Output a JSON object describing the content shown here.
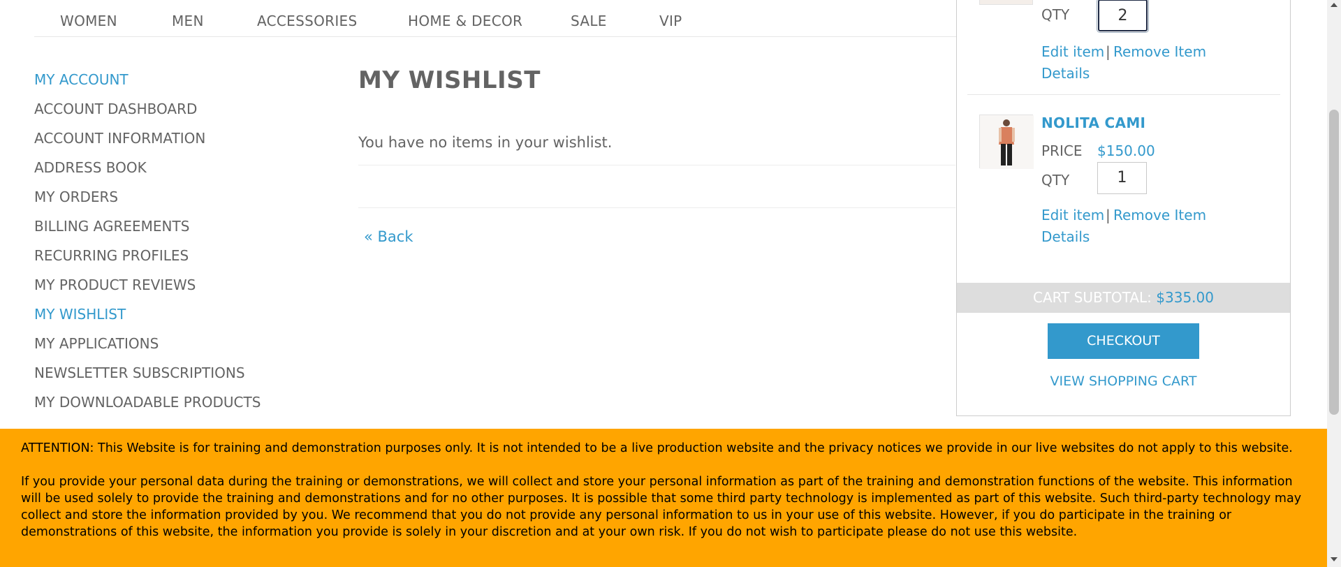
{
  "nav": {
    "items": [
      "WOMEN",
      "MEN",
      "ACCESSORIES",
      "HOME & DECOR",
      "SALE",
      "VIP"
    ]
  },
  "sidebar": {
    "title": "MY ACCOUNT",
    "items": [
      {
        "label": "ACCOUNT DASHBOARD"
      },
      {
        "label": "ACCOUNT INFORMATION"
      },
      {
        "label": "ADDRESS BOOK"
      },
      {
        "label": "MY ORDERS"
      },
      {
        "label": "BILLING AGREEMENTS"
      },
      {
        "label": "RECURRING PROFILES"
      },
      {
        "label": "MY PRODUCT REVIEWS"
      },
      {
        "label": "MY WISHLIST",
        "active": true
      },
      {
        "label": "MY APPLICATIONS"
      },
      {
        "label": "NEWSLETTER SUBSCRIPTIONS"
      },
      {
        "label": "MY DOWNLOADABLE PRODUCTS"
      }
    ]
  },
  "main": {
    "title": "MY WISHLIST",
    "empty_message": "You have no items in your wishlist.",
    "back_link": "« Back"
  },
  "minicart": {
    "items": [
      {
        "qty_label": "QTY",
        "qty": "2",
        "edit": "Edit item",
        "separator": "|",
        "remove": "Remove Item",
        "details": "Details"
      },
      {
        "name": "NOLITA CAMI",
        "price_label": "PRICE",
        "price": "$150.00",
        "qty_label": "QTY",
        "qty": "1",
        "edit": "Edit item",
        "separator": "|",
        "remove": "Remove Item",
        "details": "Details"
      }
    ],
    "subtotal_label": "CART SUBTOTAL:",
    "subtotal_value": "$335.00",
    "checkout": "CHECKOUT",
    "view_cart": "VIEW SHOPPING CART"
  },
  "notice": {
    "paragraph1": "ATTENTION: This Website is for training and demonstration purposes only. It is not intended to be a live production website and the privacy notices we provide in our live websites do not apply to this website.",
    "paragraph2": "If you provide your personal data during the training or demonstrations, we will collect and store your personal information as part of the training and demonstration functions of the website. This information will be used solely to provide the training and demonstrations and for no other purposes. It is possible that some third party technology is implemented as part of this website. Such third-party technology may collect and store the information provided by you. We recommend that you do not provide any personal information to us in your use of this website. However, if you do participate in the training or demonstrations of this website, the information you provide is solely in your discretion and at your own risk. If you do not wish to participate please do not use this website."
  },
  "colors": {
    "accent": "#3399cc",
    "text": "#636363",
    "notice_bg": "#ffa500",
    "subtotal_bg": "#dddddd"
  }
}
